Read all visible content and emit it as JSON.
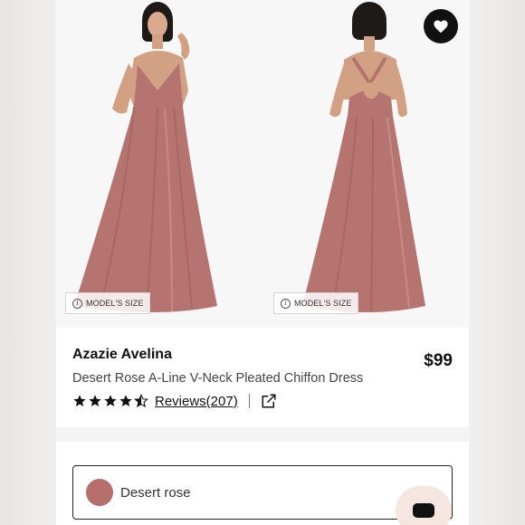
{
  "product": {
    "brand": "Azazie Avelina",
    "price": "$99",
    "title": "Desert Rose A-Line V-Neck Pleated Chiffon Dress",
    "rating": 4.5,
    "reviews_label": "Reviews(207)"
  },
  "gallery": {
    "model_size_label": "MODEL'S SIZE",
    "info_icon": "i"
  },
  "color_selector": {
    "selected_label": "Desert rose",
    "swatch_color": "#b56e6b"
  },
  "colors": {
    "dress": "#b57470",
    "accent": "#111111"
  }
}
